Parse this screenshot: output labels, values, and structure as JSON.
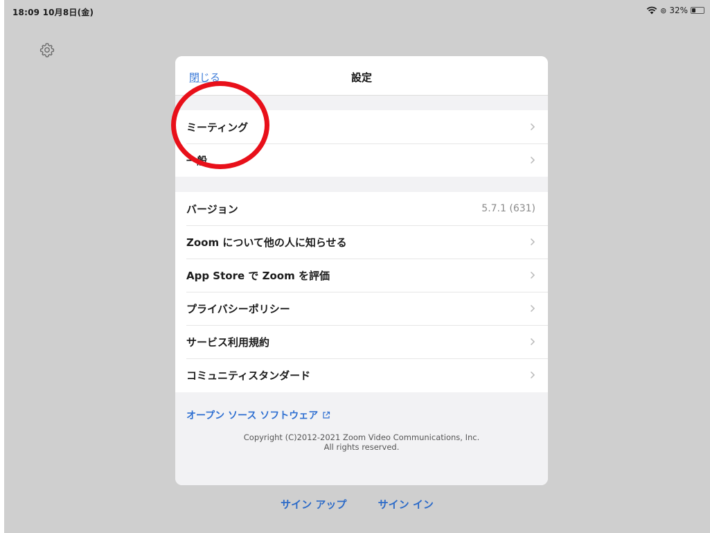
{
  "status_bar": {
    "time": "18:09  10月8日(金)",
    "battery_percent": "32%",
    "battery_level": 0.32,
    "icons": [
      "wifi-icon",
      "orientation-lock-icon",
      "battery-icon"
    ]
  },
  "background": {
    "settings_icon": "gear-icon"
  },
  "modal": {
    "close_label": "閉じる",
    "title": "設定",
    "group1": [
      {
        "label": "ミーティング"
      },
      {
        "label": "一般"
      }
    ],
    "group2": [
      {
        "label": "バージョン",
        "value": "5.7.1 (631)"
      },
      {
        "label": "Zoom について他の人に知らせる"
      },
      {
        "label": "App Store で Zoom を評価"
      },
      {
        "label": "プライバシーポリシー"
      },
      {
        "label": "サービス利用規約"
      },
      {
        "label": "コミュニティスタンダード"
      }
    ],
    "oss_label": "オープン ソース ソフトウェア",
    "copyright_line1": "Copyright (C)2012-2021 Zoom Video Communications, Inc.",
    "copyright_line2": "All rights reserved."
  },
  "bottom": {
    "signup_label": "サイン アップ",
    "signin_label": "サイン イン"
  },
  "colors": {
    "accent_blue": "#2e6fd1",
    "highlight_red": "#e8101a",
    "backdrop": "#cfcfcf"
  }
}
